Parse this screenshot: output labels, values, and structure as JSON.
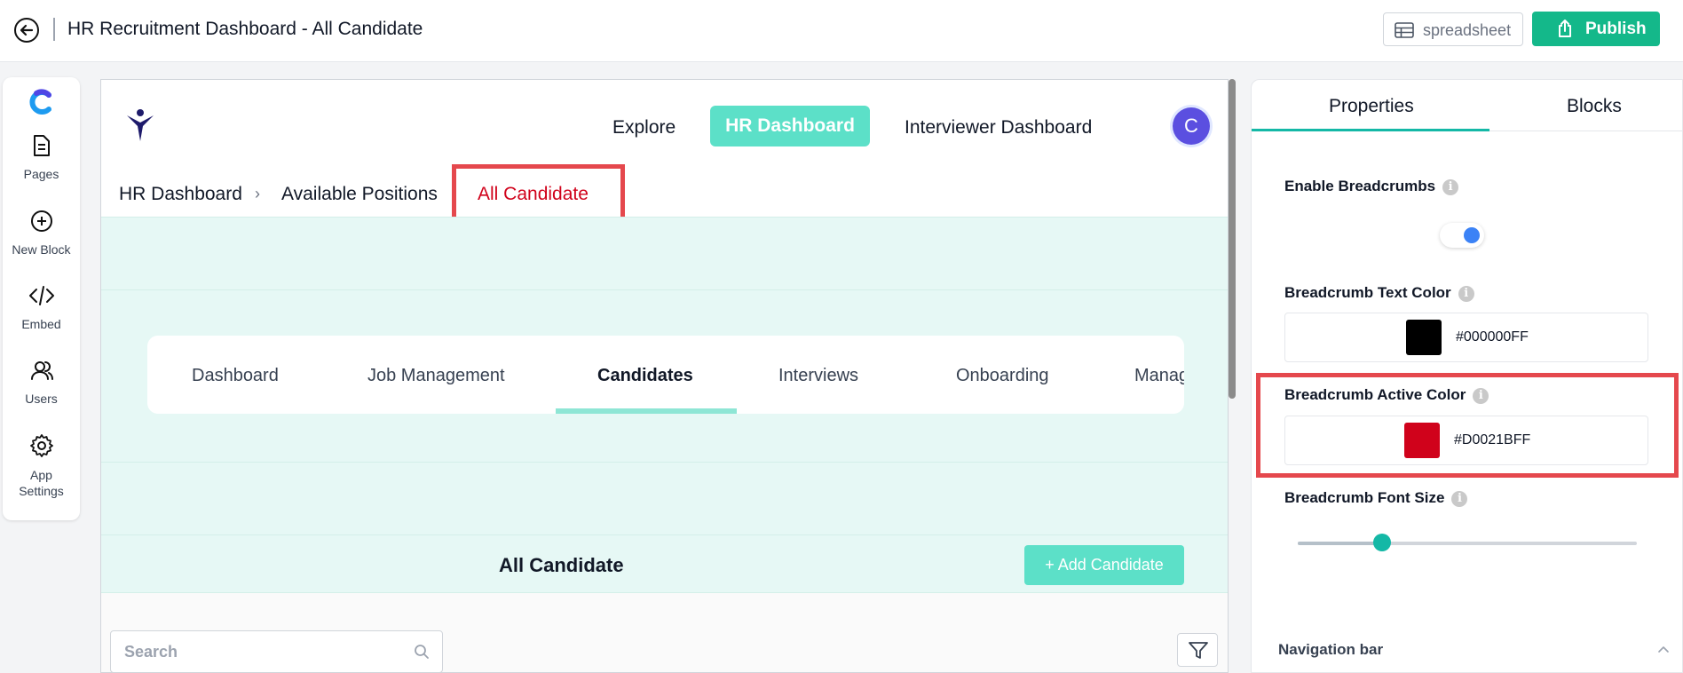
{
  "header": {
    "title": "HR Recruitment Dashboard - All Candidate",
    "spreadsheet_label": "spreadsheet",
    "publish_label": "Publish"
  },
  "left_tools": [
    {
      "label": "Pages",
      "icon": "pages-icon"
    },
    {
      "label": "New Block",
      "icon": "plus-circle-icon"
    },
    {
      "label": "Embed",
      "icon": "code-icon"
    },
    {
      "label": "Users",
      "icon": "users-icon"
    },
    {
      "label": "App Settings",
      "icon": "gear-icon"
    }
  ],
  "canvas": {
    "nav": {
      "explore": "Explore",
      "hr_dashboard": "HR Dashboard",
      "interviewer_dashboard": "Interviewer Dashboard",
      "avatar_letter": "C"
    },
    "breadcrumb": {
      "items": [
        "HR Dashboard",
        "Available Positions"
      ],
      "separator": "›",
      "active": "All Candidate"
    },
    "tabs": [
      "Dashboard",
      "Job Management",
      "Candidates",
      "Interviews",
      "Onboarding",
      "Manag"
    ],
    "active_tab": "Candidates",
    "section_title": "All Candidate",
    "add_button": "+ Add Candidate",
    "search_placeholder": "Search"
  },
  "right_panel": {
    "tabs": [
      "Properties",
      "Blocks"
    ],
    "active_tab": "Properties",
    "enable_breadcrumbs_label": "Enable Breadcrumbs",
    "enable_breadcrumbs": true,
    "text_color_label": "Breadcrumb Text Color",
    "text_color": "#000000FF",
    "active_color_label": "Breadcrumb Active Color",
    "active_color": "#D0021BFF",
    "font_size_label": "Breadcrumb Font Size",
    "navigation_bar_label": "Navigation bar"
  },
  "colors": {
    "accent_green": "#14b88a",
    "teal": "#5ce0c8",
    "breadcrumb_active": "#d0021b"
  }
}
